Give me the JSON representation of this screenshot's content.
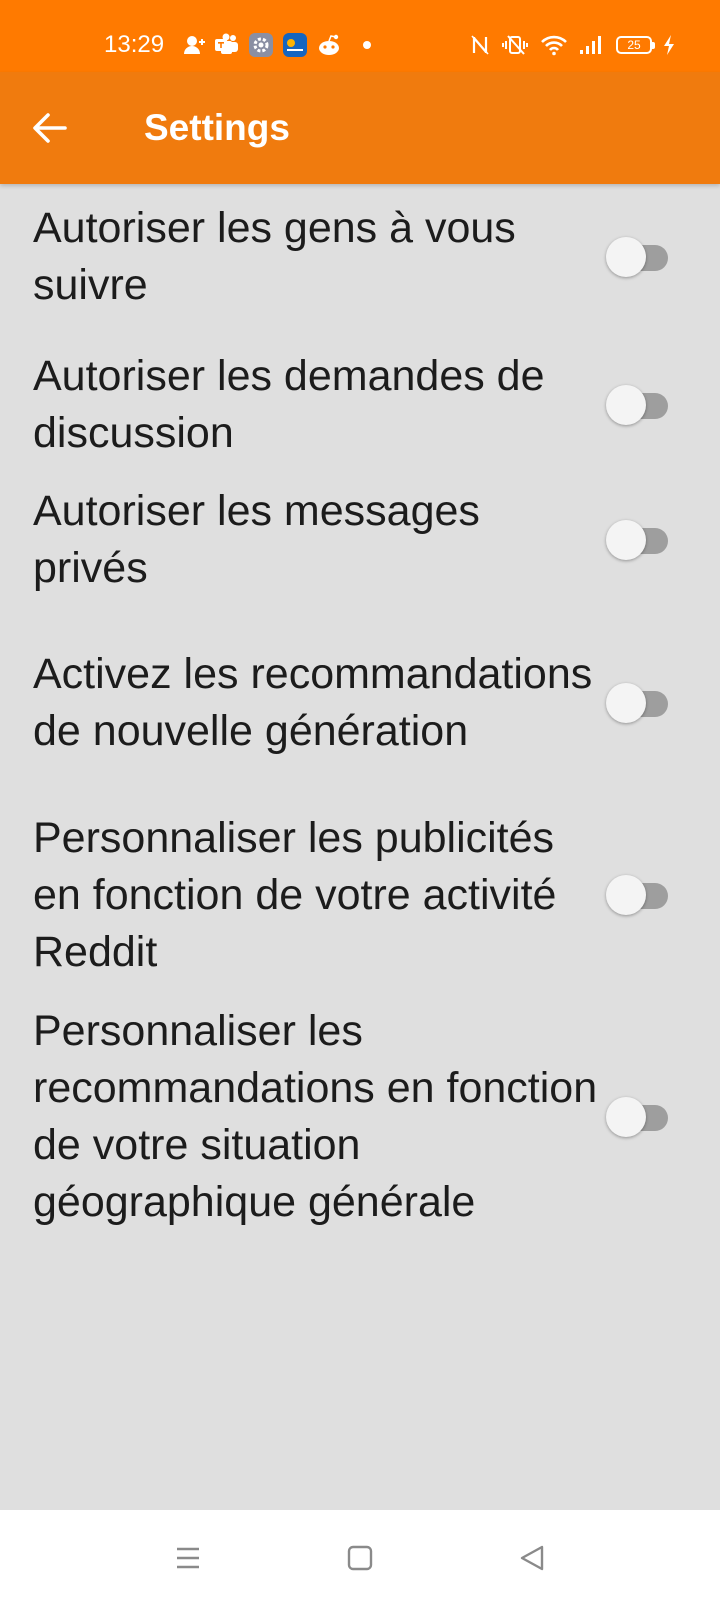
{
  "status_bar": {
    "time": "13:29",
    "battery_level": "25",
    "left_icons": [
      "add-person-icon",
      "teams-icon",
      "settings-app-icon",
      "calendar-app-icon",
      "reddit-icon",
      "dot-icon"
    ],
    "right_icons": [
      "nfc-icon",
      "vibrate-icon",
      "wifi-icon",
      "signal-icon",
      "battery-icon",
      "charging-icon"
    ]
  },
  "app_bar": {
    "title": "Settings",
    "back_icon": "back-arrow-icon"
  },
  "settings": {
    "items": [
      {
        "label": "Autoriser les gens à vous suivre",
        "enabled": false
      },
      {
        "label": "Autoriser les demandes de discussion",
        "enabled": false
      },
      {
        "label": "Autoriser les messages privés",
        "enabled": false
      },
      {
        "label": "Activez les recommandations de nouvelle génération",
        "enabled": false
      },
      {
        "label": "Personnaliser les publicités en fonction de votre activité Reddit",
        "enabled": false
      },
      {
        "label": "Personnaliser les recommandations en fonction de votre situation géographique générale",
        "enabled": false
      }
    ]
  },
  "nav_bar": {
    "buttons": [
      "menu-icon",
      "home-icon",
      "back-icon"
    ]
  },
  "colors": {
    "status_bar": "#ff7a00",
    "app_bar": "#f07b0e",
    "background": "#dfdfdf",
    "toggle_track_off": "#9e9e9e",
    "toggle_thumb": "#f4f4f4"
  }
}
